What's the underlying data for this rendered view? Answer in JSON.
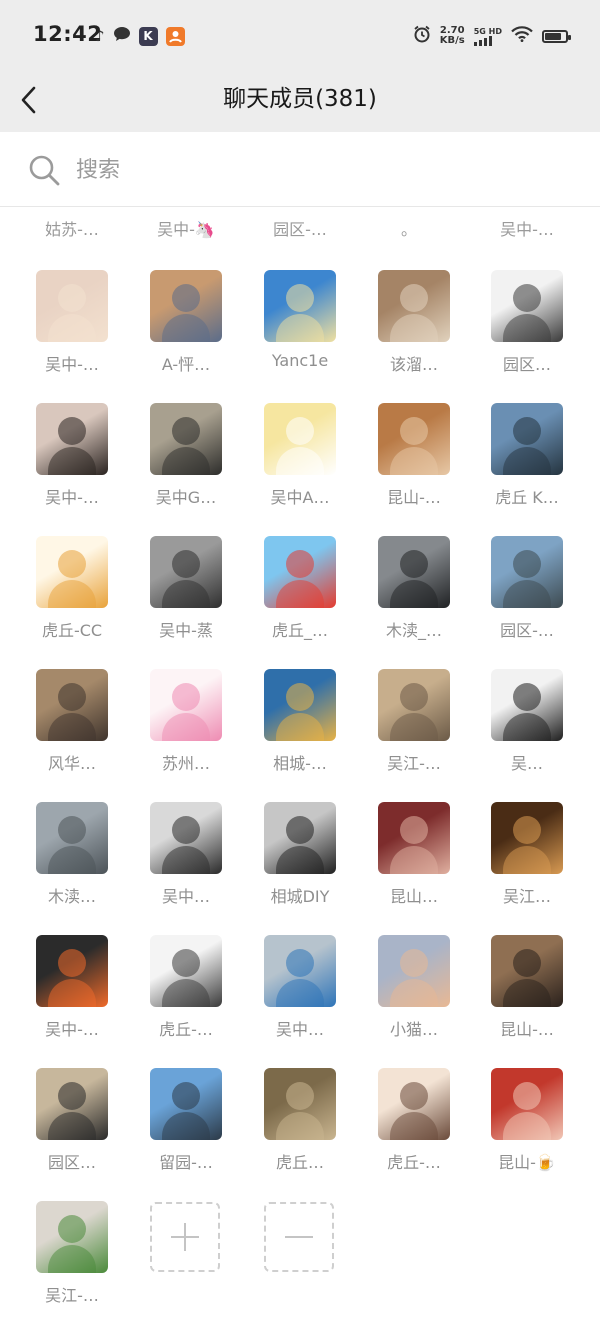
{
  "status_bar": {
    "time": "12:42",
    "left_icons": [
      "music-note-icon",
      "chat-bubble-icon",
      "k-app-icon",
      "orange-app-icon"
    ],
    "speed_value": "2.70",
    "speed_unit": "KB/s",
    "network_label": "5G HD",
    "right_icons": [
      "alarm-icon",
      "signal-icon",
      "wifi-icon",
      "battery-icon"
    ],
    "battery_level": 0.85
  },
  "header": {
    "title": "聊天成员(381)",
    "back_icon": "chevron-left-icon"
  },
  "search": {
    "placeholder": "搜索",
    "value": "",
    "icon": "search-icon"
  },
  "partial_row": [
    "姑苏-…",
    "吴中-🦄",
    "园区-…",
    "。",
    "吴中-…"
  ],
  "members": [
    {
      "name": "吴中-…",
      "avatar_colors": [
        "#e9d3c4",
        "#f3e1cf"
      ]
    },
    {
      "name": "A-怦…",
      "avatar_colors": [
        "#c89a70",
        "#5a6c8a"
      ]
    },
    {
      "name": "Yanc1e",
      "avatar_colors": [
        "#3d86cf",
        "#f0e0a0"
      ]
    },
    {
      "name": "该溜…",
      "avatar_colors": [
        "#a58466",
        "#e1d2bd"
      ]
    },
    {
      "name": "园区…",
      "avatar_colors": [
        "#f2f2f2",
        "#3a3a3a"
      ]
    },
    {
      "name": "吴中-…",
      "avatar_colors": [
        "#d9c7bd",
        "#2a2320"
      ]
    },
    {
      "name": "吴中G…",
      "avatar_colors": [
        "#a8a08f",
        "#2d2d2b"
      ]
    },
    {
      "name": "吴中A…",
      "avatar_colors": [
        "#f6e6a0",
        "#ffffff"
      ]
    },
    {
      "name": "昆山-…",
      "avatar_colors": [
        "#b97a46",
        "#e7c8a6"
      ]
    },
    {
      "name": "虎丘 K…",
      "avatar_colors": [
        "#6a8fb3",
        "#25343f"
      ]
    },
    {
      "name": "虎丘-CC",
      "avatar_colors": [
        "#fff7e6",
        "#e8a23a"
      ]
    },
    {
      "name": "吴中-蒸",
      "avatar_colors": [
        "#9a9a9a",
        "#2f2f2f"
      ]
    },
    {
      "name": "虎丘_…",
      "avatar_colors": [
        "#7ec6ef",
        "#e53b2f"
      ]
    },
    {
      "name": "木渎_…",
      "avatar_colors": [
        "#85898d",
        "#202224"
      ]
    },
    {
      "name": "园区-…",
      "avatar_colors": [
        "#7ea3c4",
        "#3d4a50"
      ]
    },
    {
      "name": "风华…",
      "avatar_colors": [
        "#a5896a",
        "#3f342d"
      ]
    },
    {
      "name": "苏州…",
      "avatar_colors": [
        "#fdf4f6",
        "#ee8bb2"
      ]
    },
    {
      "name": "相城-…",
      "avatar_colors": [
        "#2f6faa",
        "#e8b245"
      ]
    },
    {
      "name": "吴江-…",
      "avatar_colors": [
        "#c7ae8c",
        "#6b5a47"
      ]
    },
    {
      "name": "吴…",
      "avatar_colors": [
        "#f2f2f2",
        "#1e1e1e"
      ]
    },
    {
      "name": "木渎…",
      "avatar_colors": [
        "#9da6ad",
        "#4c5358"
      ]
    },
    {
      "name": "吴中…",
      "avatar_colors": [
        "#d9d9d9",
        "#2a2a2a"
      ]
    },
    {
      "name": "相城DIY",
      "avatar_colors": [
        "#c6c6c6",
        "#202020"
      ]
    },
    {
      "name": "昆山…",
      "avatar_colors": [
        "#7d2c2c",
        "#e0b0a0"
      ]
    },
    {
      "name": "吴江…",
      "avatar_colors": [
        "#4a2c15",
        "#d89a52"
      ]
    },
    {
      "name": "吴中-…",
      "avatar_colors": [
        "#2b2b2b",
        "#f06a2a"
      ]
    },
    {
      "name": "虎丘-…",
      "avatar_colors": [
        "#f4f4f4",
        "#3a3a3a"
      ]
    },
    {
      "name": "吴中…",
      "avatar_colors": [
        "#b6c3cd",
        "#2e74b8"
      ]
    },
    {
      "name": "小猫…",
      "avatar_colors": [
        "#a9b4c8",
        "#e8b894"
      ]
    },
    {
      "name": "昆山-…",
      "avatar_colors": [
        "#8f6f52",
        "#2a211c"
      ]
    },
    {
      "name": "园区…",
      "avatar_colors": [
        "#c7b79c",
        "#2a2a2a"
      ]
    },
    {
      "name": "留园-…",
      "avatar_colors": [
        "#6aa3d8",
        "#2c3a48"
      ]
    },
    {
      "name": "虎丘…",
      "avatar_colors": [
        "#7c6a4a",
        "#c9b590"
      ]
    },
    {
      "name": "虎丘-…",
      "avatar_colors": [
        "#f3e3d4",
        "#6a4a3a"
      ]
    },
    {
      "name": "昆山-🍺",
      "avatar_colors": [
        "#c2382c",
        "#f1c7b6"
      ]
    },
    {
      "name": "吴江-…",
      "avatar_colors": [
        "#dcd7cf",
        "#4a8a3a"
      ]
    }
  ],
  "actions": {
    "add_icon": "plus-icon",
    "remove_icon": "minus-icon"
  }
}
